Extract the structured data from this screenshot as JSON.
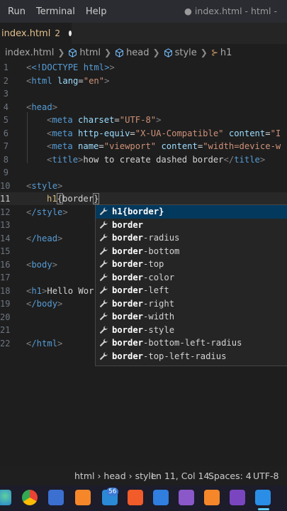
{
  "menu": [
    "Run",
    "Terminal",
    "Help"
  ],
  "window_title": "● index.html - html - ",
  "tab": {
    "name": "index.html",
    "problems": "2"
  },
  "breadcrumb": [
    "index.html",
    "html",
    "head",
    "style",
    "h1"
  ],
  "editor": {
    "lines": [
      {
        "num": "1"
      },
      {
        "num": "2"
      },
      {
        "num": "3"
      },
      {
        "num": "4"
      },
      {
        "num": "5"
      },
      {
        "num": "6"
      },
      {
        "num": "7"
      },
      {
        "num": "8"
      },
      {
        "num": "9"
      },
      {
        "num": "10"
      },
      {
        "num": "11"
      },
      {
        "num": "12"
      },
      {
        "num": "13"
      },
      {
        "num": "14"
      },
      {
        "num": "15"
      },
      {
        "num": "16"
      },
      {
        "num": "17"
      },
      {
        "num": "18"
      },
      {
        "num": "19"
      },
      {
        "num": "20"
      },
      {
        "num": "21"
      },
      {
        "num": "22"
      }
    ],
    "code": {
      "l1": "<!DOCTYPE html>",
      "l2_tag": "html",
      "l2_attr": "lang",
      "l2_val": "\"en\"",
      "l4_tag": "head",
      "l5_attr": "charset",
      "l5_val": "\"UTF-8\"",
      "l6_attr1": "http-equiv",
      "l6_val1": "\"X-UA-Compatible\"",
      "l6_attr2": "content",
      "l6_val2": "\"I",
      "l7_attr1": "name",
      "l7_val1": "\"viewport\"",
      "l7_attr2": "content",
      "l7_val2": "\"width=device-w",
      "l8_text": "how to create dashed border",
      "l10_tag": "style",
      "l11_sel": "h1",
      "l11_text": "border",
      "l12_tag": "/style",
      "l14_tag": "/head",
      "l16_tag": "body",
      "l18_tag": "h1",
      "l18_text": "Hello Wor",
      "l19_tag": "/body",
      "l22_tag": "/html"
    }
  },
  "suggestions": [
    {
      "label": "h1{border}",
      "match": "h1{border}",
      "rest": ""
    },
    {
      "label": "border",
      "match": "border",
      "rest": ""
    },
    {
      "label": "border-radius",
      "match": "border",
      "rest": "-radius"
    },
    {
      "label": "border-bottom",
      "match": "border",
      "rest": "-bottom"
    },
    {
      "label": "border-top",
      "match": "border",
      "rest": "-top"
    },
    {
      "label": "border-color",
      "match": "border",
      "rest": "-color"
    },
    {
      "label": "border-left",
      "match": "border",
      "rest": "-left"
    },
    {
      "label": "border-right",
      "match": "border",
      "rest": "-right"
    },
    {
      "label": "border-width",
      "match": "border",
      "rest": "-width"
    },
    {
      "label": "border-style",
      "match": "border",
      "rest": "-style"
    },
    {
      "label": "border-bottom-left-radius",
      "match": "border",
      "rest": "-bottom-left-radius"
    },
    {
      "label": "border-top-left-radius",
      "match": "border",
      "rest": "-top-left-radius"
    }
  ],
  "status": {
    "path": "html › head › style",
    "position": "Ln 11, Col 14",
    "spaces": "Spaces: 4",
    "encoding": "UTF-8"
  },
  "taskbar": {
    "badge": "56",
    "icons": [
      "edge-icon",
      "chrome-icon",
      "store-icon",
      "xampp-icon",
      "messages-icon",
      "brave-icon",
      "mail-icon",
      "visual-studio-icon",
      "xampp-icon",
      "visual-studio-icon",
      "vscode-icon"
    ]
  },
  "colors": {
    "accent": "#04395e",
    "tag": "#569cd6",
    "string": "#ce9178",
    "attribute": "#9cdcfe"
  }
}
